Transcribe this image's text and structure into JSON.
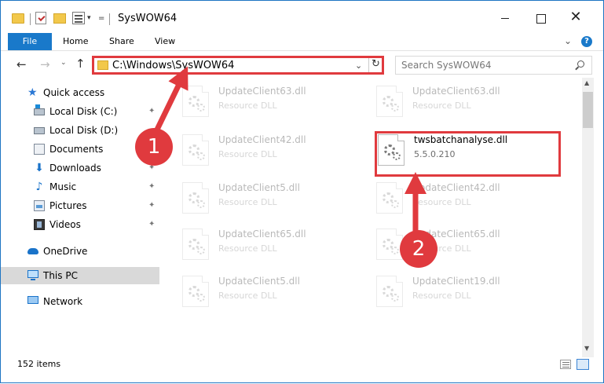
{
  "window": {
    "title": "SysWOW64",
    "quick_access_dropdown": "=",
    "minimize_icon": "minimize-icon",
    "maximize_icon": "maximize-icon",
    "close_label": "✕"
  },
  "ribbon": {
    "tabs": [
      "File",
      "Home",
      "Share",
      "View"
    ],
    "help_label": "?",
    "chevron_label": "⌄"
  },
  "nav": {
    "back_label": "←",
    "forward_label": "→",
    "recent_label": "⌄",
    "up_label": "↑",
    "address": "C:\\Windows\\SysWOW64",
    "address_dropdown": "⌄",
    "refresh_label": "↻",
    "search_placeholder": "Search SysWOW64"
  },
  "sidebar": {
    "items": [
      {
        "label": "Quick access",
        "icon": "star-icon"
      },
      {
        "label": "Local Disk (C:)",
        "icon": "drive-icon",
        "pinned": true
      },
      {
        "label": "Local Disk (D:)",
        "icon": "drive-icon"
      },
      {
        "label": "Documents",
        "icon": "documents-icon",
        "pinned": true
      },
      {
        "label": "Downloads",
        "icon": "download-icon",
        "pinned": true
      },
      {
        "label": "Music",
        "icon": "music-icon",
        "pinned": true
      },
      {
        "label": "Pictures",
        "icon": "pictures-icon",
        "pinned": true
      },
      {
        "label": "Videos",
        "icon": "videos-icon",
        "pinned": true
      },
      {
        "label": "OneDrive",
        "icon": "cloud-icon"
      },
      {
        "label": "This PC",
        "icon": "computer-icon",
        "selected": true
      },
      {
        "label": "Network",
        "icon": "network-icon"
      }
    ],
    "pin_glyph": "📌"
  },
  "files": {
    "left": [
      {
        "name": "UpdateClient63.dll",
        "sub": "Resource DLL"
      },
      {
        "name": "UpdateClient42.dll",
        "sub": "Resource DLL"
      },
      {
        "name": "UpdateClient5.dll",
        "sub": "Resource DLL"
      },
      {
        "name": "UpdateClient65.dll",
        "sub": "Resource DLL"
      },
      {
        "name": "UpdateClient5.dll",
        "sub": "Resource DLL"
      }
    ],
    "right": [
      {
        "name": "UpdateClient63.dll",
        "sub": "Resource DLL"
      },
      {
        "name": "twsbatchanalyse.dll",
        "sub": "5.5.0.210",
        "highlighted": true
      },
      {
        "name": "UpdateClient42.dll",
        "sub": "Resource DLL"
      },
      {
        "name": "UpdateClient65.dll",
        "sub": "Resource DLL"
      },
      {
        "name": "UpdateClient19.dll",
        "sub": "Resource DLL"
      }
    ]
  },
  "status": {
    "item_count": "152 items"
  },
  "annotations": {
    "step1": "1",
    "step2": "2",
    "color": "#e03a3e"
  },
  "colors": {
    "accent": "#1979ca",
    "highlight": "#e03a3e",
    "selected_bg": "#d9d9d9"
  }
}
